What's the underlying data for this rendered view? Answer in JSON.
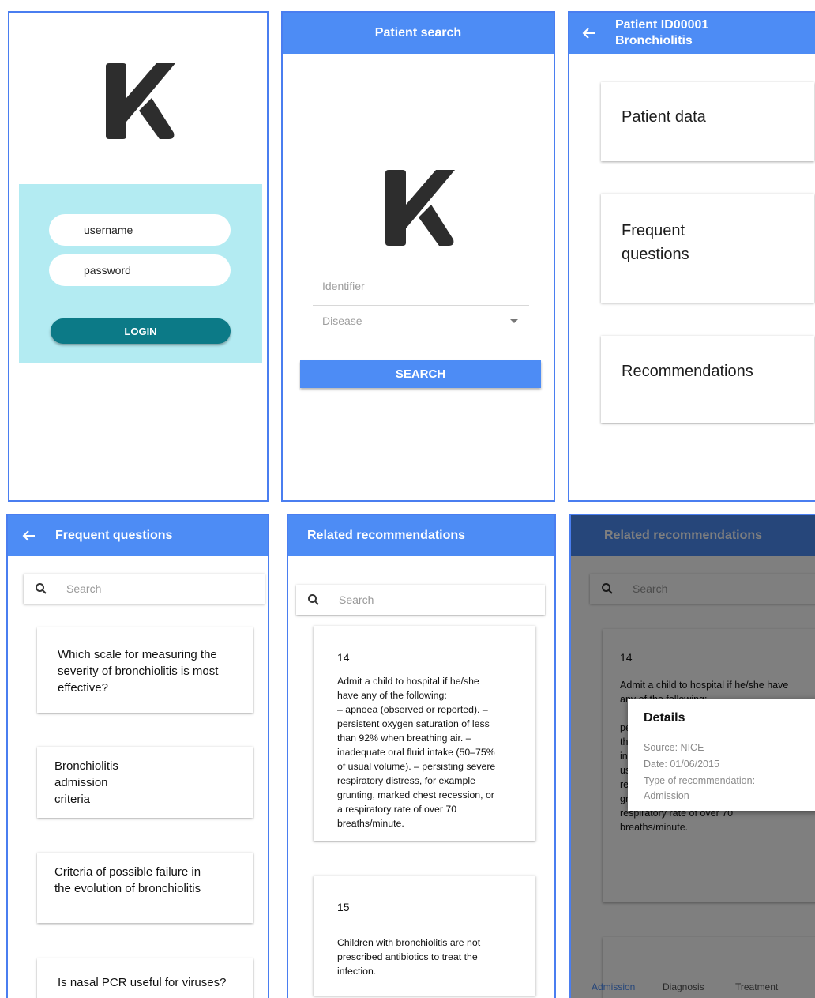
{
  "login": {
    "username_placeholder": "username",
    "password_placeholder": "password",
    "login_button": "LOGIN"
  },
  "patient_search": {
    "title": "Patient search",
    "identifier_placeholder": "Identifier",
    "disease_placeholder": "Disease",
    "search_button": "SEARCH"
  },
  "patient_menu": {
    "title_line1": "Patient ID00001",
    "title_line2": "Bronchiolitis",
    "cards": [
      {
        "line1": "Patient data",
        "line2": ""
      },
      {
        "line1": "Frequent",
        "line2": "questions"
      },
      {
        "line1": "Recommendations",
        "line2": ""
      }
    ]
  },
  "faq": {
    "title": "Frequent questions",
    "search_placeholder": "Search",
    "questions": [
      {
        "lines": [
          "Which scale for measuring the",
          "severity of bronchiolitis is most",
          "effective?"
        ]
      },
      {
        "lines": [
          "Bronchiolitis",
          "admission",
          "criteria"
        ]
      },
      {
        "lines": [
          "Criteria of possible failure in",
          "the evolution of bronchiolitis"
        ]
      },
      {
        "lines": [
          "Is nasal PCR useful for viruses?"
        ]
      }
    ]
  },
  "recommendations": {
    "title": "Related recommendations",
    "search_placeholder": "Search",
    "items": [
      {
        "number": "14",
        "lines": [
          "Admit a child to hospital if he/she",
          "have any of the following:",
          "– apnoea (observed or reported). –",
          "persistent oxygen saturation of less",
          "than 92% when breathing air. –",
          "inadequate oral fluid intake (50–75%",
          "of usual volume). – persisting severe",
          "respiratory distress, for example",
          "grunting, marked chest recession, or",
          "a respiratory rate of over 70",
          "breaths/minute."
        ]
      },
      {
        "number": "15",
        "lines": [
          "Children with bronchiolitis are not",
          "prescribed antibiotics to treat the",
          "infection."
        ]
      }
    ]
  },
  "details_view": {
    "title": "Related recommendations",
    "search_placeholder": "Search",
    "number": "14",
    "bg_lines": [
      "Admit a child to hospital if he/she have",
      "any of the following:",
      "–",
      "pe",
      "th",
      "in",
      "us",
      "re",
      "gr",
      "respiratory rate of over 70",
      "breaths/minute."
    ],
    "dialog": {
      "title": "Details",
      "source": "Source: NICE",
      "date": "Date: 01/06/2015",
      "type_label": "Type of recommendation:",
      "type_value": "Admission"
    },
    "tabs": [
      "Admission",
      "Diagnosis",
      "Treatment"
    ]
  },
  "colors": {
    "accent": "#4d8cf5",
    "screen_border": "#4a7ef0",
    "login_panel": "#b3ebf2",
    "login_button": "#0c7a87",
    "logo": "#2d2d2d"
  }
}
